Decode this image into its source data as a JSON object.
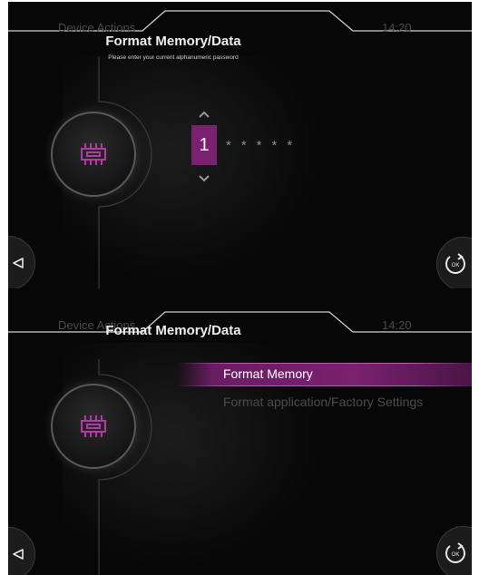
{
  "password_screen": {
    "nav": {
      "left": "Device Actions",
      "title": "Format Memory/Data",
      "time": "14:20"
    },
    "prompt": "Please enter your current alphanumeric password",
    "current_digit": "1",
    "masked_chars": "*****",
    "icons": {
      "device": "memory-chip-icon",
      "back": "back-triangle-icon",
      "ok": "ok-refresh-icon"
    },
    "ok_label": "OK"
  },
  "menu_screen": {
    "nav": {
      "left": "Device Actions",
      "title": "Format Memory/Data",
      "time": "14:20"
    },
    "menu_items": [
      {
        "label": "Format Memory",
        "selected": true
      },
      {
        "label": "Format application/Factory Settings",
        "selected": false
      }
    ],
    "icons": {
      "device": "memory-chip-icon",
      "back": "back-triangle-icon",
      "ok": "ok-refresh-icon"
    },
    "ok_label": "OK"
  },
  "colors": {
    "accent": "#7a2170",
    "chip_icon": "#b23aa6",
    "background": "#070707",
    "dim_text": "#4a4a4a"
  }
}
